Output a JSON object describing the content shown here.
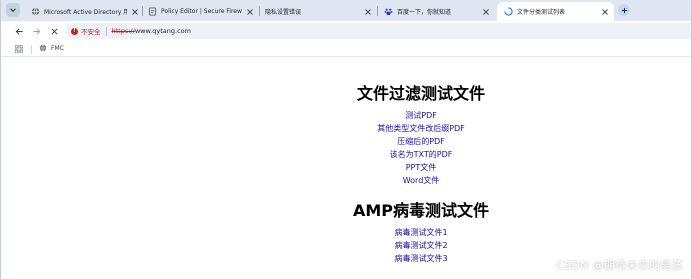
{
  "tabs": [
    {
      "title": "Microsoft Active Directory 用",
      "icon": "globe-icon",
      "active": false
    },
    {
      "title": "Policy Editor | Secure Firewall",
      "icon": "policy-page-icon",
      "active": false
    },
    {
      "title": "隐私设置错误",
      "icon": "none",
      "active": false
    },
    {
      "title": "百度一下，你就知道",
      "icon": "baidu-paw-icon",
      "active": false
    },
    {
      "title": "文件分类测试列表",
      "icon": "loading-spinner-icon",
      "active": true
    }
  ],
  "toolbar": {
    "security_label": "不安全",
    "url_scheme": "https://",
    "url_host": "www.qytang.com"
  },
  "bookmarks": [
    {
      "label": "FMC",
      "icon": "globe-icon"
    }
  ],
  "page": {
    "heading1": "文件过滤测试文件",
    "links1": [
      "测试PDF",
      "其他类型文件改后缀PDF",
      "压缩后的PDF",
      "该名为TXT的PDF",
      "PPT文件",
      "Word文件"
    ],
    "heading2": "AMP病毒测试文件",
    "links2": [
      "病毒测试文件1",
      "病毒测试文件2",
      "病毒测试文件3"
    ]
  },
  "watermark": "CSDN @期待未来的男孩",
  "colors": {
    "tabstrip": "#dee6f2",
    "link": "#1a0dab",
    "insecure": "#c5221f"
  }
}
